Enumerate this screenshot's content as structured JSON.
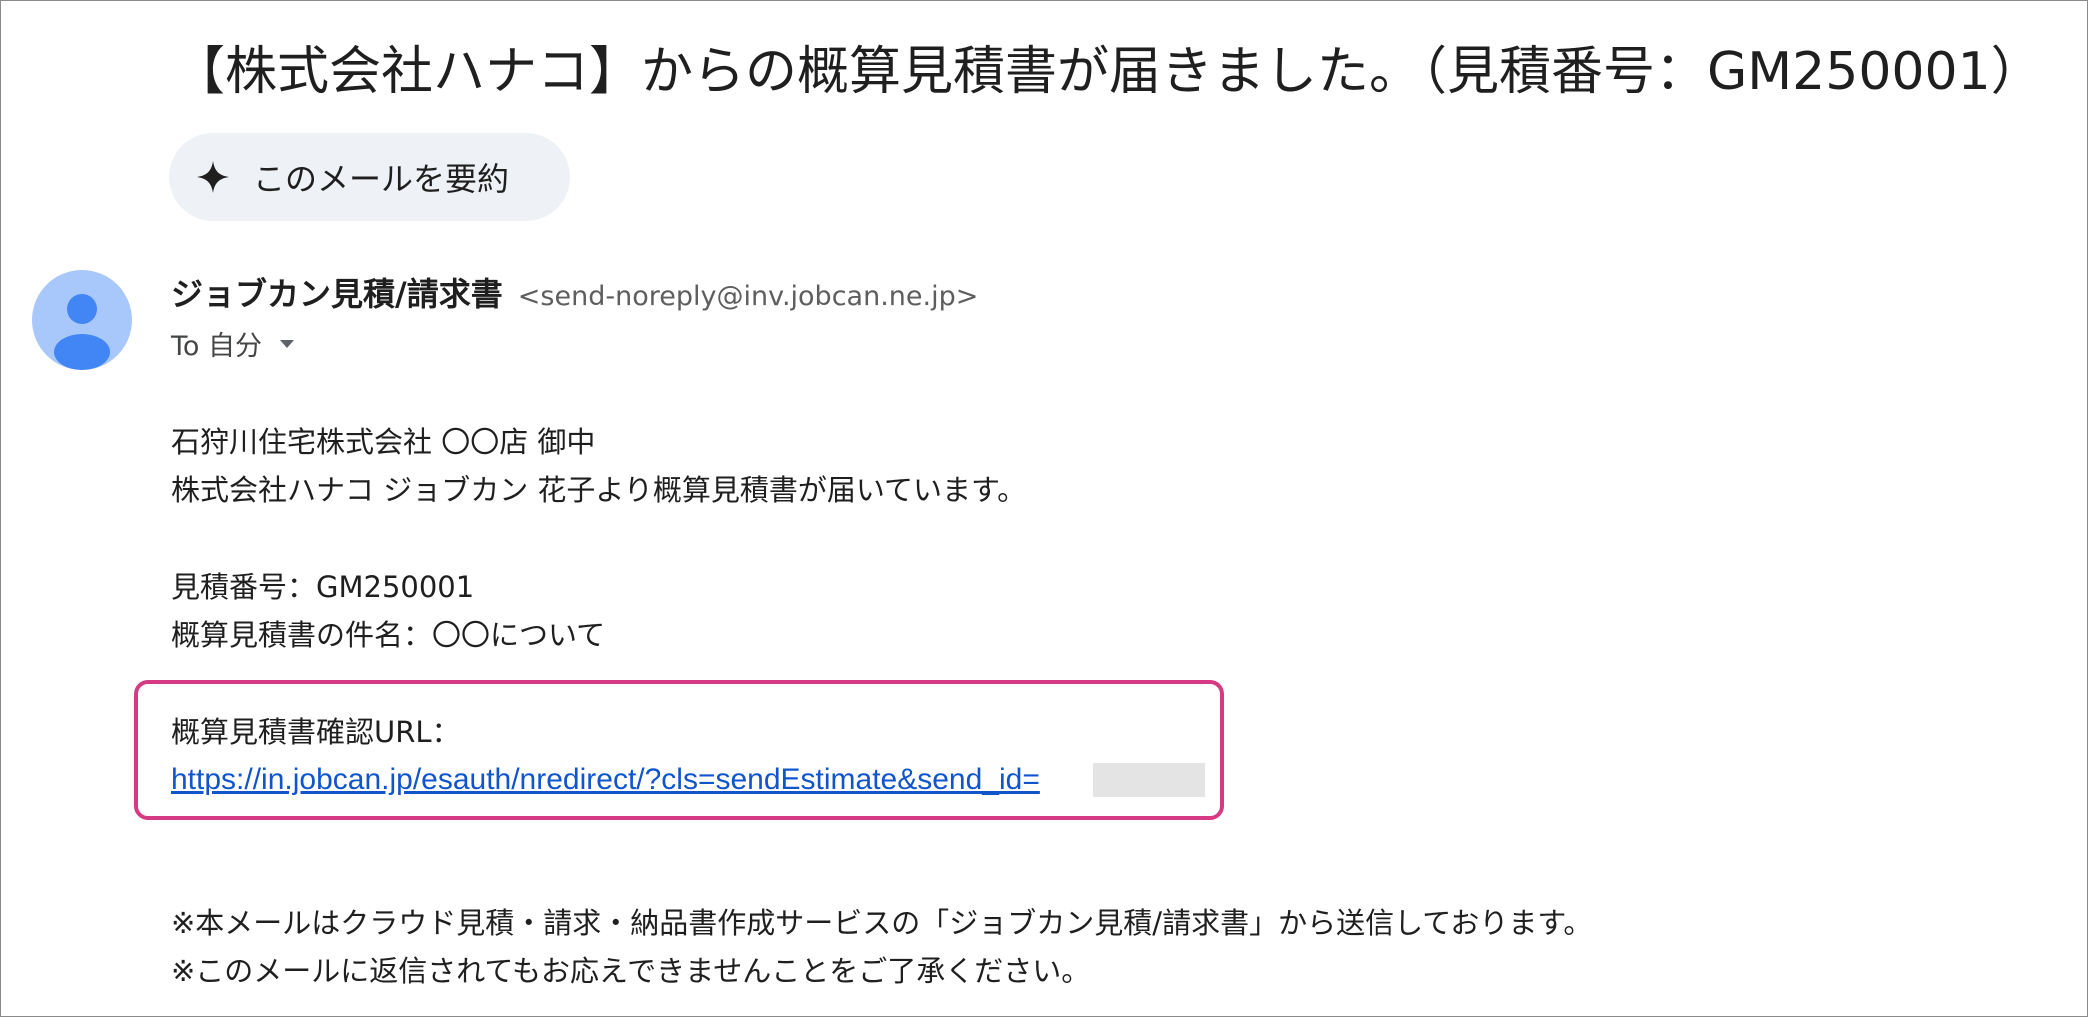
{
  "email": {
    "subject": "【株式会社ハナコ】からの概算見積書が届きました。（見積番号：GM250001）",
    "summarize_button": "このメールを要約",
    "sender": {
      "name": "ジョブカン見積/請求書",
      "email": "<send-noreply@inv.jobcan.ne.jp>"
    },
    "to": "To 自分",
    "body": {
      "line1": "石狩川住宅株式会社 〇〇店 御中",
      "line2": "株式会社ハナコ ジョブカン 花子より概算見積書が届いています。",
      "estimate_number": "見積番号：GM250001",
      "estimate_subject": "概算見積書の件名：〇〇について",
      "url_label": "概算見積書確認URL：",
      "url": "https://in.jobcan.jp/esauth/nredirect/?cls=sendEstimate&send_id=",
      "footer1": "※本メールはクラウド見積・請求・納品書作成サービスの「ジョブカン見積/請求書」から送信しております。",
      "footer2": "※このメールに返信されてもお応えできませんことをご了承ください。"
    }
  },
  "colors": {
    "highlight_border": "#d63a82",
    "link": "#1155cc",
    "avatar_bg": "#a8c7fa",
    "avatar_fg": "#4285f4",
    "chip_bg": "#eef1f6"
  },
  "icons": {
    "summarize": "sparkle-icon",
    "avatar": "default-person-icon",
    "recipients": "dropdown-arrow-icon"
  }
}
